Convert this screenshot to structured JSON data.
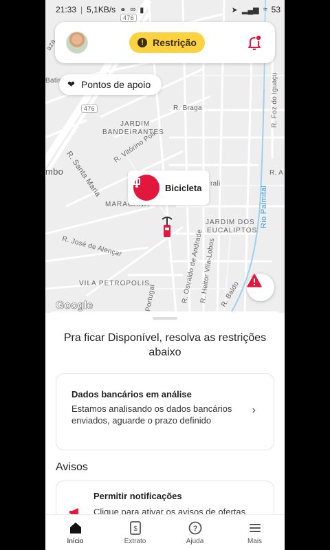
{
  "status_bar": {
    "time": "21:33",
    "speed": "5,1KB/s",
    "battery": "53"
  },
  "map": {
    "labels": {
      "jardim_bandeirantes_1": "JARDIM",
      "jardim_bandeirantes_2": "BANDEIRANTES",
      "r_braga": "R. Braga",
      "r_santa_maria": "R. Santa Maria",
      "r_vitorino_poli": "R. Vitórino Poli",
      "r_jose_alencar": "R. José de Alençar",
      "vila_petropolis": "VILA PETROPOLIS",
      "jardim_eucaliptos_1": "JARDIM DOS",
      "jardim_eucaliptos_2": "EUCALIPTOS",
      "r_osvaldo_andrade": "R. Osvaldo de Andrade",
      "r_heitor_vila_lobos": "R. Heitor Vila-Lobos",
      "rio_palmital": "Rio Palmital",
      "r_foz_iguacu": "R. Foz do Iguaçu",
      "maracana": "MARACANÃ",
      "mbo": "mbo",
      "route_476_top": "476",
      "route_476_mid": "476",
      "r_baldo": "R. Baldo",
      "portugal": "Portugal",
      "grali": "rali",
      "r_a": "R. A",
      "batista": "Batist",
      "aza": "aza"
    },
    "google": "Google"
  },
  "top_card": {
    "restriction_label": "Restrição"
  },
  "support": {
    "label": "Pontos de apoio"
  },
  "bike_marker": {
    "label": "Bicicleta"
  },
  "sheet": {
    "title": "Pra ficar Disponível, resolva as restrições abaixo",
    "restriction": {
      "title": "Dados bancários em análise",
      "description": "Estamos analisando os dados bancários enviados, aguarde o prazo definido"
    },
    "notices_title": "Avisos",
    "notification": {
      "title": "Permitir notificações",
      "description": "Clique para ativar os avisos de ofertas"
    }
  },
  "nav": {
    "items": [
      {
        "label": "Início",
        "icon": "home-icon",
        "active": true
      },
      {
        "label": "Extrato",
        "icon": "statement-icon",
        "active": false
      },
      {
        "label": "Ajuda",
        "icon": "help-icon",
        "active": false
      },
      {
        "label": "Mais",
        "icon": "menu-icon",
        "active": false
      }
    ]
  },
  "colors": {
    "accent_red": "#e3173e",
    "restriction_yellow": "#fcd240",
    "river_blue": "#3b9be3"
  }
}
